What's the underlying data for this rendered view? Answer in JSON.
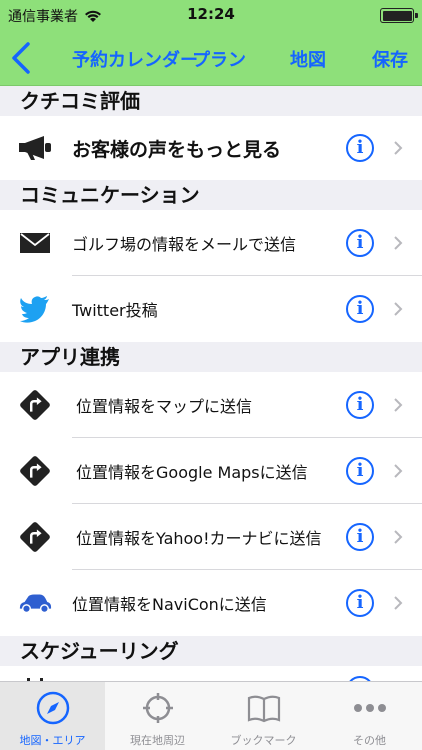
{
  "status": {
    "carrier": "通信事業者",
    "time": "12:24"
  },
  "nav": {
    "items": [
      "予約カレンダー",
      "プラン",
      "地図",
      "保存"
    ]
  },
  "sections": [
    {
      "title": "クチコミ評価",
      "rows": [
        {
          "label": "お客様の声をもっと見る",
          "icon": "megaphone-icon"
        }
      ]
    },
    {
      "title": "コミュニケーション",
      "rows": [
        {
          "label": "ゴルフ場の情報をメールで送信",
          "icon": "envelope-icon"
        },
        {
          "label": "Twitter投稿",
          "icon": "twitter-bird-icon"
        }
      ]
    },
    {
      "title": "アプリ連携",
      "rows": [
        {
          "label": "位置情報をマップに送信",
          "icon": "direction-sign-icon"
        },
        {
          "label": "位置情報をGoogle Mapsに送信",
          "icon": "direction-sign-icon"
        },
        {
          "label": "位置情報をYahoo!カーナビに送信",
          "icon": "direction-sign-icon"
        },
        {
          "label": "位置情報をNaviConに送信",
          "icon": "car-icon"
        }
      ]
    },
    {
      "title": "スケジューリング",
      "rows": []
    }
  ],
  "tabs": [
    {
      "label": "地図・エリア",
      "icon": "compass-icon",
      "active": true
    },
    {
      "label": "現在地周辺",
      "icon": "crosshair-icon",
      "active": false
    },
    {
      "label": "ブックマーク",
      "icon": "book-icon",
      "active": false
    },
    {
      "label": "その他",
      "icon": "more-dots-icon",
      "active": false
    }
  ],
  "colors": {
    "accent": "#1565ff",
    "bar": "#8ee07a",
    "section": "#efeff4"
  }
}
